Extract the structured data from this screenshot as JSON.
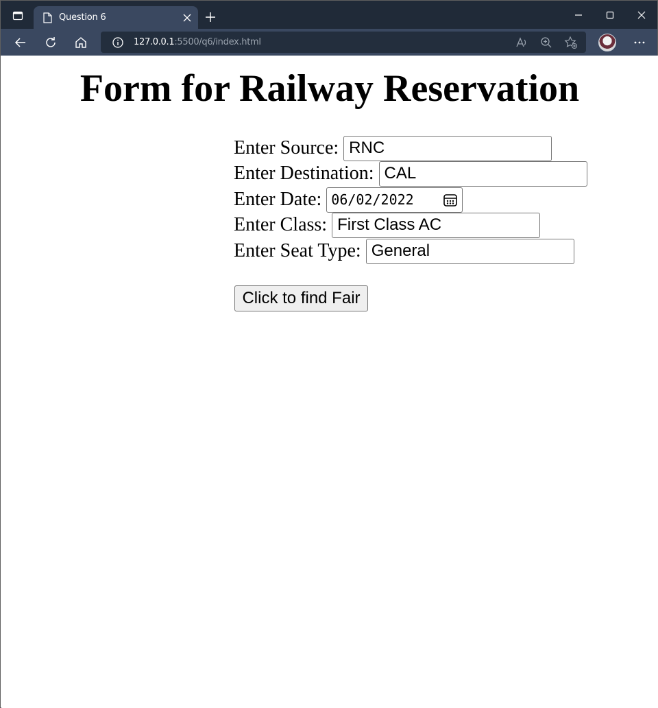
{
  "browser": {
    "tab_title": "Question 6",
    "address_host": "127.0.0.1",
    "address_rest": ":5500/q6/index.html"
  },
  "page": {
    "title": "Form for Railway Reservation",
    "fields": {
      "source": {
        "label": "Enter Source:",
        "value": "RNC"
      },
      "destination": {
        "label": "Enter Destination:",
        "value": "CAL"
      },
      "date": {
        "label": "Enter Date:",
        "value": "06/02/2022"
      },
      "class": {
        "label": "Enter Class:",
        "value": "First Class AC"
      },
      "seat_type": {
        "label": "Enter Seat Type:",
        "value": "General"
      }
    },
    "submit_label": "Click to find Fair"
  },
  "icons": [
    "tab-actions-icon",
    "page-icon",
    "close-icon",
    "plus-icon",
    "minimize-icon",
    "maximize-icon",
    "close-window-icon",
    "back-icon",
    "refresh-icon",
    "home-icon",
    "info-icon",
    "read-aloud-icon",
    "zoom-icon",
    "favorites-icon",
    "avatar",
    "more-icon",
    "calendar-icon"
  ],
  "colors": {
    "tabbar": "#202a38",
    "toolbar": "#3a4860",
    "address_bg": "#232e3d",
    "button_bg": "#efefef"
  }
}
